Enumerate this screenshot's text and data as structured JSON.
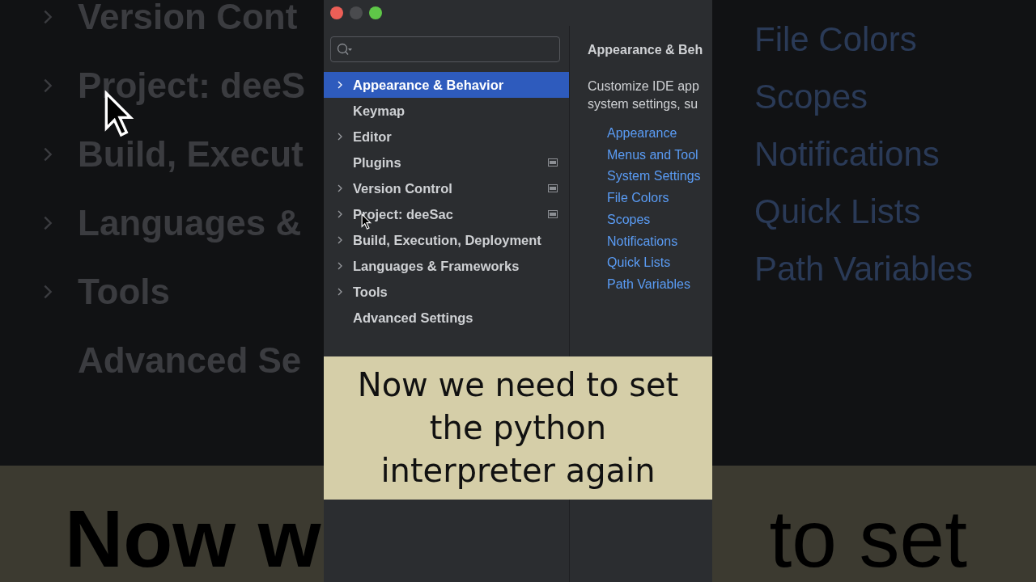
{
  "backdrop": {
    "left_items": [
      {
        "label": "Version Cont",
        "expandable": true
      },
      {
        "label": "Project: deeS",
        "expandable": true
      },
      {
        "label": "Build, Execut",
        "expandable": true
      },
      {
        "label": "Languages &",
        "expandable": true
      },
      {
        "label": "Tools",
        "expandable": true
      },
      {
        "label": "Advanced Se",
        "expandable": false
      }
    ],
    "right_links": [
      "File Colors",
      "Scopes",
      "Notifications",
      "Quick Lists",
      "Path Variables"
    ],
    "caption_left": "Now w",
    "caption_right": "to set"
  },
  "settings": {
    "tree": [
      {
        "label": "Appearance & Behavior",
        "expandable": true,
        "selected": true,
        "badge": false
      },
      {
        "label": "Keymap",
        "expandable": false,
        "selected": false,
        "badge": false
      },
      {
        "label": "Editor",
        "expandable": true,
        "selected": false,
        "badge": false
      },
      {
        "label": "Plugins",
        "expandable": false,
        "selected": false,
        "badge": true
      },
      {
        "label": "Version Control",
        "expandable": true,
        "selected": false,
        "badge": true
      },
      {
        "label": "Project: deeSac",
        "expandable": true,
        "selected": false,
        "badge": true
      },
      {
        "label": "Build, Execution, Deployment",
        "expandable": true,
        "selected": false,
        "badge": false
      },
      {
        "label": "Languages & Frameworks",
        "expandable": true,
        "selected": false,
        "badge": false
      },
      {
        "label": "Tools",
        "expandable": true,
        "selected": false,
        "badge": false
      },
      {
        "label": "Advanced Settings",
        "expandable": false,
        "selected": false,
        "badge": false
      }
    ],
    "detail": {
      "title": "Appearance & Beh",
      "description": [
        "Customize IDE app",
        "system settings, su"
      ],
      "links": [
        "Appearance",
        "Menus and Tool",
        "System Settings",
        "File Colors",
        "Scopes",
        "Notifications",
        "Quick Lists",
        "Path Variables"
      ]
    }
  },
  "caption": {
    "lines": [
      "Now we need to set",
      "the python",
      "interpreter again"
    ]
  }
}
